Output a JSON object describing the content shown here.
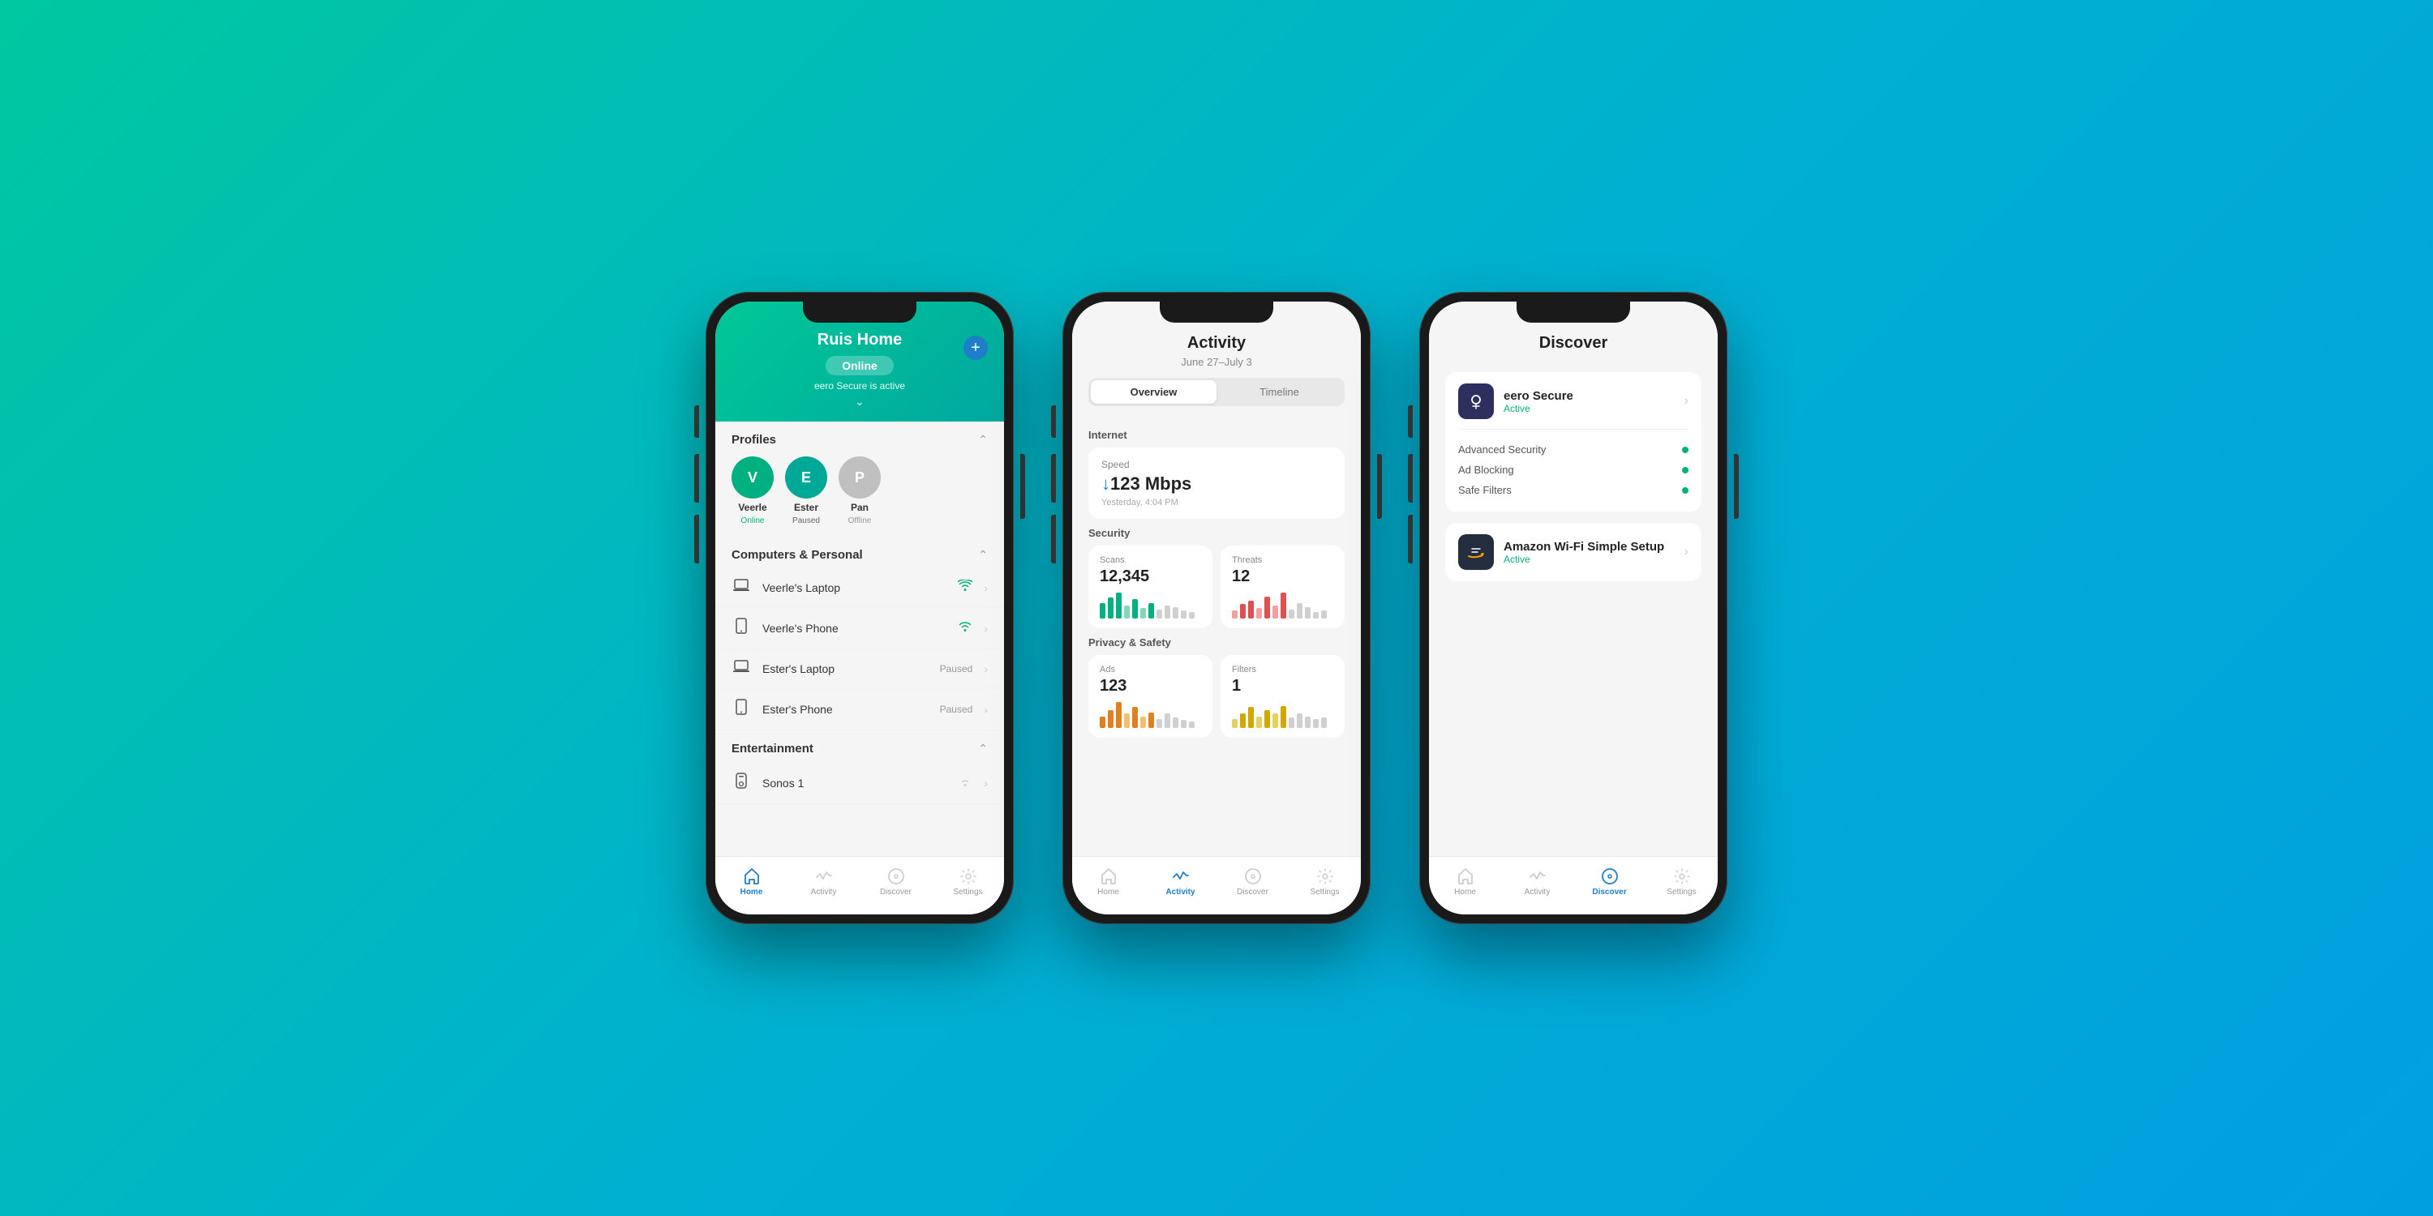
{
  "background": {
    "gradient_start": "#00c8a0",
    "gradient_end": "#00a0e0"
  },
  "phone1": {
    "header": {
      "title": "Ruis Home",
      "status": "Online",
      "secure_text": "eero Secure is active",
      "add_button": "+"
    },
    "profiles_section": {
      "title": "Profiles",
      "collapse_icon": "chevron-up",
      "profiles": [
        {
          "initial": "V",
          "name": "Veerle",
          "status": "Online",
          "status_class": "status-online",
          "avatar_class": "avatar-green"
        },
        {
          "initial": "E",
          "name": "Ester",
          "status": "Paused",
          "status_class": "status-paused",
          "avatar_class": "avatar-teal"
        },
        {
          "initial": "P",
          "name": "Pan",
          "status": "Offline",
          "status_class": "status-offline",
          "avatar_class": "avatar-gray"
        }
      ]
    },
    "computers_section": {
      "title": "Computers & Personal",
      "collapse_icon": "chevron-up",
      "devices": [
        {
          "type": "laptop",
          "name": "Veerle's Laptop",
          "status": "wifi",
          "status_text": ""
        },
        {
          "type": "phone",
          "name": "Veerle's Phone",
          "status": "wifi",
          "status_text": ""
        },
        {
          "type": "laptop",
          "name": "Ester's Laptop",
          "status": "paused",
          "status_text": "Paused"
        },
        {
          "type": "phone",
          "name": "Ester's Phone",
          "status": "paused",
          "status_text": "Paused"
        }
      ]
    },
    "entertainment_section": {
      "title": "Entertainment",
      "devices": [
        {
          "type": "speaker",
          "name": "Sonos 1",
          "status": "wifi",
          "status_text": ""
        }
      ]
    },
    "bottom_nav": {
      "items": [
        {
          "icon": "home",
          "label": "Home",
          "active": true
        },
        {
          "icon": "activity",
          "label": "Activity",
          "active": false
        },
        {
          "icon": "discover",
          "label": "Discover",
          "active": false
        },
        {
          "icon": "settings",
          "label": "Settings",
          "active": false
        }
      ]
    }
  },
  "phone2": {
    "header": {
      "title": "Activity",
      "date_range": "June 27–July 3",
      "tabs": [
        {
          "label": "Overview",
          "active": true
        },
        {
          "label": "Timeline",
          "active": false
        }
      ]
    },
    "internet_section": {
      "title": "Internet",
      "speed_card": {
        "label": "Speed",
        "arrow": "↓",
        "value": "123 Mbps",
        "time": "Yesterday, 4:04 PM"
      }
    },
    "security_section": {
      "title": "Security",
      "scans_card": {
        "label": "Scans",
        "value": "12,345",
        "bars": [
          4,
          6,
          8,
          5,
          7,
          6,
          8,
          3,
          5,
          7,
          4,
          6
        ]
      },
      "threats_card": {
        "label": "Threats",
        "value": "12",
        "bars": [
          2,
          4,
          5,
          3,
          6,
          4,
          7,
          3,
          5,
          4,
          2,
          3
        ]
      }
    },
    "privacy_section": {
      "title": "Privacy & Safety",
      "ads_card": {
        "label": "Ads",
        "value": "123",
        "bars": [
          3,
          5,
          7,
          4,
          6,
          5,
          4,
          3,
          5,
          4,
          3,
          2
        ]
      },
      "filters_card": {
        "label": "Filters",
        "value": "1",
        "bars": [
          2,
          4,
          6,
          3,
          5,
          4,
          6,
          3,
          4,
          5,
          3,
          4
        ]
      }
    },
    "bottom_nav": {
      "items": [
        {
          "icon": "home",
          "label": "Home",
          "active": false
        },
        {
          "icon": "activity",
          "label": "Activity",
          "active": true
        },
        {
          "icon": "discover",
          "label": "Discover",
          "active": false
        },
        {
          "icon": "settings",
          "label": "Settings",
          "active": false
        }
      ]
    }
  },
  "phone3": {
    "header": {
      "title": "Discover"
    },
    "eero_secure_card": {
      "service_name": "eero Secure",
      "status": "Active",
      "features": [
        {
          "label": "Advanced Security",
          "enabled": true
        },
        {
          "label": "Ad Blocking",
          "enabled": true
        },
        {
          "label": "Safe Filters",
          "enabled": true
        }
      ]
    },
    "amazon_card": {
      "service_name": "Amazon Wi-Fi Simple Setup",
      "status": "Active"
    },
    "bottom_nav": {
      "items": [
        {
          "icon": "home",
          "label": "Home",
          "active": false
        },
        {
          "icon": "activity",
          "label": "Activity",
          "active": false
        },
        {
          "icon": "discover",
          "label": "Discover",
          "active": true
        },
        {
          "icon": "settings",
          "label": "Settings",
          "active": false
        }
      ]
    }
  }
}
